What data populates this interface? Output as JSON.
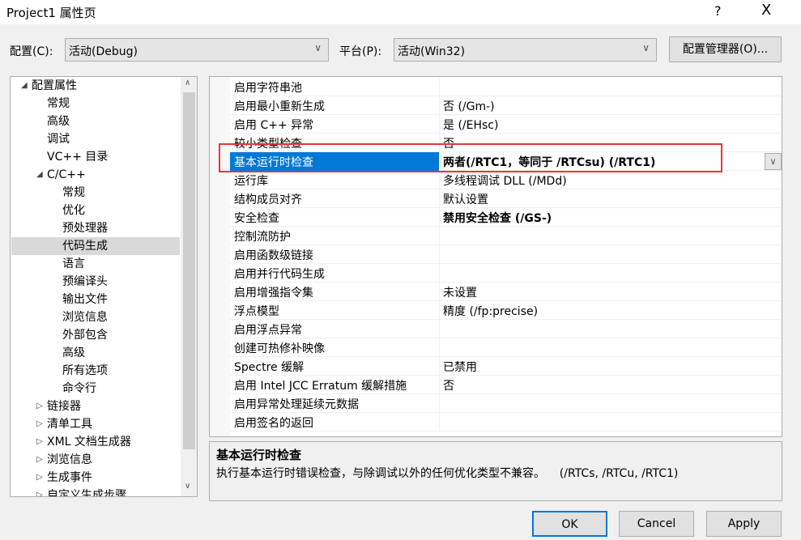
{
  "window": {
    "title": "Project1 属性页",
    "help": "?",
    "close": "X"
  },
  "toolbar": {
    "config_label": "配置(C):",
    "config_value": "活动(Debug)",
    "platform_label": "平台(P):",
    "platform_value": "活动(Win32)",
    "manager_button": "配置管理器(O)..."
  },
  "tree": {
    "items": [
      {
        "label": "配置属性",
        "level": 0,
        "expander": "expanded"
      },
      {
        "label": "常规",
        "level": 1
      },
      {
        "label": "高级",
        "level": 1
      },
      {
        "label": "调试",
        "level": 1
      },
      {
        "label": "VC++ 目录",
        "level": 1
      },
      {
        "label": "C/C++",
        "level": 1,
        "expander": "expanded"
      },
      {
        "label": "常规",
        "level": 2
      },
      {
        "label": "优化",
        "level": 2
      },
      {
        "label": "预处理器",
        "level": 2
      },
      {
        "label": "代码生成",
        "level": 2,
        "selected": true
      },
      {
        "label": "语言",
        "level": 2
      },
      {
        "label": "预编译头",
        "level": 2
      },
      {
        "label": "输出文件",
        "level": 2
      },
      {
        "label": "浏览信息",
        "level": 2
      },
      {
        "label": "外部包含",
        "level": 2
      },
      {
        "label": "高级",
        "level": 2
      },
      {
        "label": "所有选项",
        "level": 2
      },
      {
        "label": "命令行",
        "level": 2
      },
      {
        "label": "链接器",
        "level": 1,
        "expander": "collapsed"
      },
      {
        "label": "清单工具",
        "level": 1,
        "expander": "collapsed"
      },
      {
        "label": "XML 文档生成器",
        "level": 1,
        "expander": "collapsed"
      },
      {
        "label": "浏览信息",
        "level": 1,
        "expander": "collapsed"
      },
      {
        "label": "生成事件",
        "level": 1,
        "expander": "collapsed"
      },
      {
        "label": "自定义生成步骤",
        "level": 1,
        "expander": "collapsed"
      }
    ]
  },
  "grid": {
    "rows": [
      {
        "name": "启用字符串池",
        "value": ""
      },
      {
        "name": "启用最小重新生成",
        "value": "否 (/Gm-)"
      },
      {
        "name": "启用 C++ 异常",
        "value": "是 (/EHsc)"
      },
      {
        "name": "较小类型检查",
        "value": "否"
      },
      {
        "name": "基本运行时检查",
        "value": "两者(/RTC1，等同于 /RTCsu) (/RTC1)",
        "bold": true,
        "selected": true
      },
      {
        "name": "运行库",
        "value": "多线程调试 DLL (/MDd)"
      },
      {
        "name": "结构成员对齐",
        "value": "默认设置"
      },
      {
        "name": "安全检查",
        "value": "禁用安全检查 (/GS-)",
        "bold": true
      },
      {
        "name": "控制流防护",
        "value": ""
      },
      {
        "name": "启用函数级链接",
        "value": ""
      },
      {
        "name": "启用并行代码生成",
        "value": ""
      },
      {
        "name": "启用增强指令集",
        "value": "未设置"
      },
      {
        "name": "浮点模型",
        "value": "精度 (/fp:precise)"
      },
      {
        "name": "启用浮点异常",
        "value": ""
      },
      {
        "name": "创建可热修补映像",
        "value": ""
      },
      {
        "name": "Spectre 缓解",
        "value": "已禁用"
      },
      {
        "name": "启用 Intel JCC Erratum 缓解措施",
        "value": "否"
      },
      {
        "name": "启用异常处理延续元数据",
        "value": ""
      },
      {
        "name": "启用签名的返回",
        "value": ""
      }
    ]
  },
  "description": {
    "title": "基本运行时检查",
    "text": "执行基本运行时错误检查，与除调试以外的任何优化类型不兼容。    (/RTCs, /RTCu, /RTC1)"
  },
  "buttons": {
    "ok": "OK",
    "cancel": "Cancel",
    "apply": "Apply"
  },
  "colors": {
    "selection": "#0078d7",
    "highlight_box": "#e8363a"
  }
}
